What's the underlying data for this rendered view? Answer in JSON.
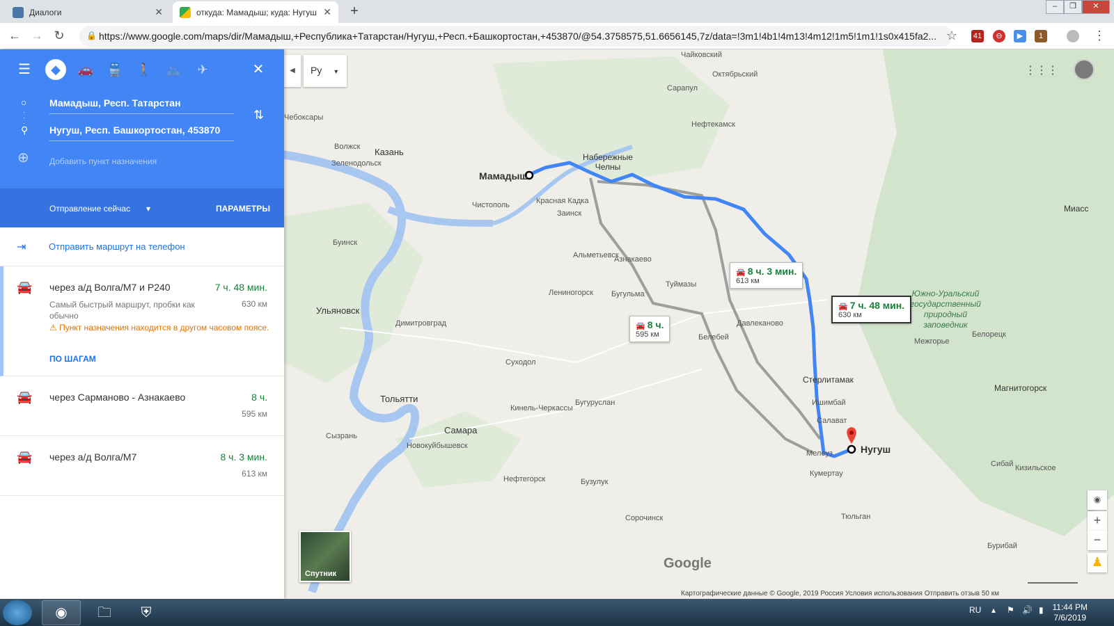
{
  "browser": {
    "tabs": [
      {
        "title": "Диалоги"
      },
      {
        "title": "откуда: Мамадыш; куда: Нугуш"
      }
    ],
    "url": "https://www.google.com/maps/dir/Мамадыш,+Республика+Татарстан/Нугуш,+Респ.+Башкортостан,+453870/@54.3758575,51.6656145,7z/data=!3m1!4b1!4m13!4m12!1m5!1m1!1s0x415fa2...",
    "ext_badges": [
      "41",
      "1"
    ]
  },
  "directions": {
    "origin": "Мамадыш, Респ. Татарстан",
    "destination": "Нугуш, Респ. Башкортостан, 453870",
    "add_destination": "Добавить пункт назначения",
    "depart_label": "Отправление сейчас",
    "params_label": "ПАРАМЕТРЫ",
    "send_to_phone": "Отправить маршрут на телефон",
    "routes": [
      {
        "via": "через а/д Волга/M7 и Р240",
        "time": "7 ч. 48 мин.",
        "distance": "630 км",
        "description": "Самый быстрый маршрут, пробки как обычно",
        "warning": "Пункт назначения находится в другом часовом поясе.",
        "steps_label": "ПО ШАГАМ"
      },
      {
        "via": "через Сарманово - Азнакаево",
        "time": "8 ч.",
        "distance": "595 км"
      },
      {
        "via": "через а/д Волга/M7",
        "time": "8 ч. 3 мин.",
        "distance": "613 км"
      }
    ]
  },
  "map": {
    "lang": "Ру",
    "satellite_label": "Спутник",
    "google_logo": "Google",
    "callouts": [
      {
        "time": "8 ч. 3 мин.",
        "distance": "613 км"
      },
      {
        "time": "7 ч. 48 мин.",
        "distance": "630 км"
      },
      {
        "time": "8 ч.",
        "distance": "595 км"
      }
    ],
    "labels": {
      "mamadysh": "Мамадыш",
      "nugush": "Нугуш",
      "kazan": "Казань",
      "ulyanovsk": "Ульяновск",
      "togliatti": "Тольятти",
      "samara": "Самара",
      "chelny": "Набережные Челны",
      "sterlitamak": "Стерлитамак",
      "magnitogorsk": "Магнитогорск",
      "miass": "Миасс",
      "nefte": "Нефтекамск",
      "sarapul": "Сарапул",
      "chaikovsky": "Чайковский",
      "chistopol": "Чистополь",
      "almet": "Альметьевск",
      "bugulma": "Бугульма",
      "leninogorsk": "Лениногорск",
      "tuymazy": "Туймазы",
      "dimitrovgrad": "Димитровград",
      "syzran": "Сызрань",
      "novokuyb": "Новокуйбышевск",
      "ishimbay": "Ишимбай",
      "salavat": "Салават",
      "kumertau": "Кумертау",
      "buzuluk": "Бузулук",
      "beloretsk": "Белорецк",
      "krasnaya": "Красная Кадка",
      "belebey": "Белебей",
      "zelenodolsk": "Зеленодольск",
      "cheboksary": "Чебоксары",
      "volzhsk": "Волжск",
      "forest": "Южно-Уральский государственный природный заповедник",
      "oktyabrsky": "Октябрьский",
      "buinsk": "Буинск",
      "sukhodol": "Суходол",
      "zainsk": "Заинск",
      "davlekanovo": "Давлеканово",
      "aznakaevo": "Азнакаево",
      "neftegorsk": "Нефтегорск",
      "sorochinsk": "Сорочинск",
      "tyulgan": "Тюльган",
      "buribay": "Бурибай",
      "sibai": "Сибай",
      "kizilskoe": "Кизильское",
      "bugulma2": "Бугуруслан",
      "kinel": "Кинель-Черкассы",
      "meleuz": "Мелеуз",
      "mezhgorye": "Межгорье"
    },
    "footer": "Картографические данные © Google, 2019   Россия   Условия использования   Отправить отзыв   50 км"
  },
  "taskbar": {
    "lang": "RU",
    "time": "11:44 PM",
    "date": "7/6/2019"
  },
  "colors": {
    "panel_blue": "#4285f4",
    "route_selected": "#4285f4",
    "route_alt": "#9e9e9e",
    "time_green": "#188038"
  }
}
